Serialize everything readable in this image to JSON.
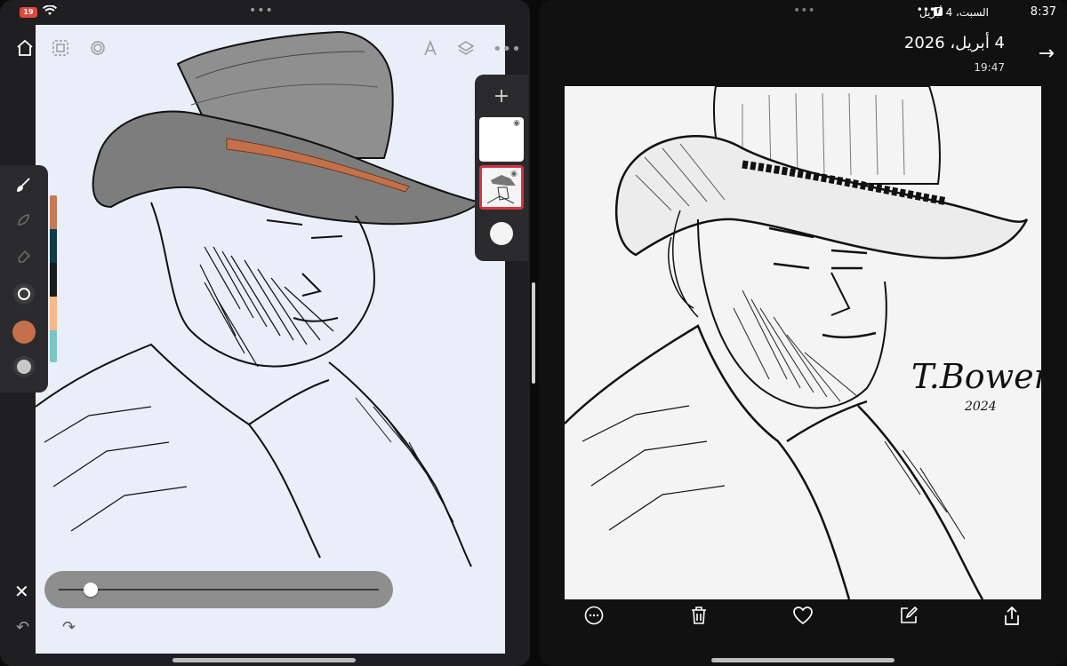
{
  "left_status": {
    "battery": "19"
  },
  "left_app": {
    "top_icons": [
      "home-icon",
      "selection-icon",
      "transform-icon",
      "ruler-icon",
      "layers-icon",
      "more-icon"
    ],
    "tools": [
      "brush-icon",
      "smudge-icon",
      "eraser-icon",
      "brush-size-icon",
      "color-icon",
      "opacity-icon"
    ],
    "palette": [
      "#c47a55",
      "#0f3b45",
      "#1b1b1b",
      "#f5b98a",
      "#7bc4c9"
    ],
    "current_color": "#c4704a",
    "layers_add": "+",
    "slider_value": 0.08
  },
  "right_status": {
    "time": "8:37",
    "date": "السبت، 4 أبريل"
  },
  "right_app": {
    "header_date": "4 أبريل، 2026",
    "header_time": "19:47",
    "signature": "T.Bowen",
    "signature_year": "2024",
    "bottom_icons": [
      "more-icon",
      "delete-icon",
      "favorite-icon",
      "edit-icon",
      "share-icon"
    ]
  }
}
